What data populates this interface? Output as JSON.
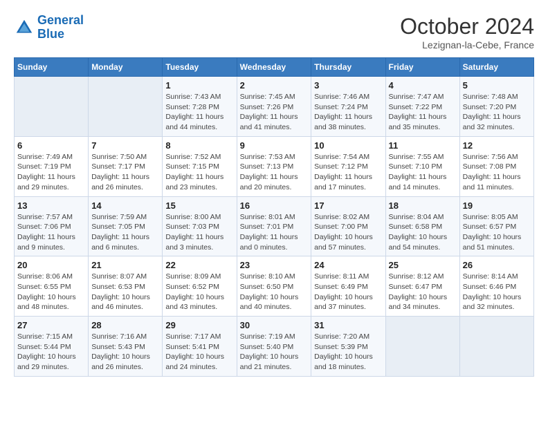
{
  "header": {
    "logo_line1": "General",
    "logo_line2": "Blue",
    "month": "October 2024",
    "location": "Lezignan-la-Cebe, France"
  },
  "days_of_week": [
    "Sunday",
    "Monday",
    "Tuesday",
    "Wednesday",
    "Thursday",
    "Friday",
    "Saturday"
  ],
  "weeks": [
    [
      {
        "day": "",
        "sunrise": "",
        "sunset": "",
        "daylight": ""
      },
      {
        "day": "",
        "sunrise": "",
        "sunset": "",
        "daylight": ""
      },
      {
        "day": "1",
        "sunrise": "Sunrise: 7:43 AM",
        "sunset": "Sunset: 7:28 PM",
        "daylight": "Daylight: 11 hours and 44 minutes."
      },
      {
        "day": "2",
        "sunrise": "Sunrise: 7:45 AM",
        "sunset": "Sunset: 7:26 PM",
        "daylight": "Daylight: 11 hours and 41 minutes."
      },
      {
        "day": "3",
        "sunrise": "Sunrise: 7:46 AM",
        "sunset": "Sunset: 7:24 PM",
        "daylight": "Daylight: 11 hours and 38 minutes."
      },
      {
        "day": "4",
        "sunrise": "Sunrise: 7:47 AM",
        "sunset": "Sunset: 7:22 PM",
        "daylight": "Daylight: 11 hours and 35 minutes."
      },
      {
        "day": "5",
        "sunrise": "Sunrise: 7:48 AM",
        "sunset": "Sunset: 7:20 PM",
        "daylight": "Daylight: 11 hours and 32 minutes."
      }
    ],
    [
      {
        "day": "6",
        "sunrise": "Sunrise: 7:49 AM",
        "sunset": "Sunset: 7:19 PM",
        "daylight": "Daylight: 11 hours and 29 minutes."
      },
      {
        "day": "7",
        "sunrise": "Sunrise: 7:50 AM",
        "sunset": "Sunset: 7:17 PM",
        "daylight": "Daylight: 11 hours and 26 minutes."
      },
      {
        "day": "8",
        "sunrise": "Sunrise: 7:52 AM",
        "sunset": "Sunset: 7:15 PM",
        "daylight": "Daylight: 11 hours and 23 minutes."
      },
      {
        "day": "9",
        "sunrise": "Sunrise: 7:53 AM",
        "sunset": "Sunset: 7:13 PM",
        "daylight": "Daylight: 11 hours and 20 minutes."
      },
      {
        "day": "10",
        "sunrise": "Sunrise: 7:54 AM",
        "sunset": "Sunset: 7:12 PM",
        "daylight": "Daylight: 11 hours and 17 minutes."
      },
      {
        "day": "11",
        "sunrise": "Sunrise: 7:55 AM",
        "sunset": "Sunset: 7:10 PM",
        "daylight": "Daylight: 11 hours and 14 minutes."
      },
      {
        "day": "12",
        "sunrise": "Sunrise: 7:56 AM",
        "sunset": "Sunset: 7:08 PM",
        "daylight": "Daylight: 11 hours and 11 minutes."
      }
    ],
    [
      {
        "day": "13",
        "sunrise": "Sunrise: 7:57 AM",
        "sunset": "Sunset: 7:06 PM",
        "daylight": "Daylight: 11 hours and 9 minutes."
      },
      {
        "day": "14",
        "sunrise": "Sunrise: 7:59 AM",
        "sunset": "Sunset: 7:05 PM",
        "daylight": "Daylight: 11 hours and 6 minutes."
      },
      {
        "day": "15",
        "sunrise": "Sunrise: 8:00 AM",
        "sunset": "Sunset: 7:03 PM",
        "daylight": "Daylight: 11 hours and 3 minutes."
      },
      {
        "day": "16",
        "sunrise": "Sunrise: 8:01 AM",
        "sunset": "Sunset: 7:01 PM",
        "daylight": "Daylight: 11 hours and 0 minutes."
      },
      {
        "day": "17",
        "sunrise": "Sunrise: 8:02 AM",
        "sunset": "Sunset: 7:00 PM",
        "daylight": "Daylight: 10 hours and 57 minutes."
      },
      {
        "day": "18",
        "sunrise": "Sunrise: 8:04 AM",
        "sunset": "Sunset: 6:58 PM",
        "daylight": "Daylight: 10 hours and 54 minutes."
      },
      {
        "day": "19",
        "sunrise": "Sunrise: 8:05 AM",
        "sunset": "Sunset: 6:57 PM",
        "daylight": "Daylight: 10 hours and 51 minutes."
      }
    ],
    [
      {
        "day": "20",
        "sunrise": "Sunrise: 8:06 AM",
        "sunset": "Sunset: 6:55 PM",
        "daylight": "Daylight: 10 hours and 48 minutes."
      },
      {
        "day": "21",
        "sunrise": "Sunrise: 8:07 AM",
        "sunset": "Sunset: 6:53 PM",
        "daylight": "Daylight: 10 hours and 46 minutes."
      },
      {
        "day": "22",
        "sunrise": "Sunrise: 8:09 AM",
        "sunset": "Sunset: 6:52 PM",
        "daylight": "Daylight: 10 hours and 43 minutes."
      },
      {
        "day": "23",
        "sunrise": "Sunrise: 8:10 AM",
        "sunset": "Sunset: 6:50 PM",
        "daylight": "Daylight: 10 hours and 40 minutes."
      },
      {
        "day": "24",
        "sunrise": "Sunrise: 8:11 AM",
        "sunset": "Sunset: 6:49 PM",
        "daylight": "Daylight: 10 hours and 37 minutes."
      },
      {
        "day": "25",
        "sunrise": "Sunrise: 8:12 AM",
        "sunset": "Sunset: 6:47 PM",
        "daylight": "Daylight: 10 hours and 34 minutes."
      },
      {
        "day": "26",
        "sunrise": "Sunrise: 8:14 AM",
        "sunset": "Sunset: 6:46 PM",
        "daylight": "Daylight: 10 hours and 32 minutes."
      }
    ],
    [
      {
        "day": "27",
        "sunrise": "Sunrise: 7:15 AM",
        "sunset": "Sunset: 5:44 PM",
        "daylight": "Daylight: 10 hours and 29 minutes."
      },
      {
        "day": "28",
        "sunrise": "Sunrise: 7:16 AM",
        "sunset": "Sunset: 5:43 PM",
        "daylight": "Daylight: 10 hours and 26 minutes."
      },
      {
        "day": "29",
        "sunrise": "Sunrise: 7:17 AM",
        "sunset": "Sunset: 5:41 PM",
        "daylight": "Daylight: 10 hours and 24 minutes."
      },
      {
        "day": "30",
        "sunrise": "Sunrise: 7:19 AM",
        "sunset": "Sunset: 5:40 PM",
        "daylight": "Daylight: 10 hours and 21 minutes."
      },
      {
        "day": "31",
        "sunrise": "Sunrise: 7:20 AM",
        "sunset": "Sunset: 5:39 PM",
        "daylight": "Daylight: 10 hours and 18 minutes."
      },
      {
        "day": "",
        "sunrise": "",
        "sunset": "",
        "daylight": ""
      },
      {
        "day": "",
        "sunrise": "",
        "sunset": "",
        "daylight": ""
      }
    ]
  ]
}
